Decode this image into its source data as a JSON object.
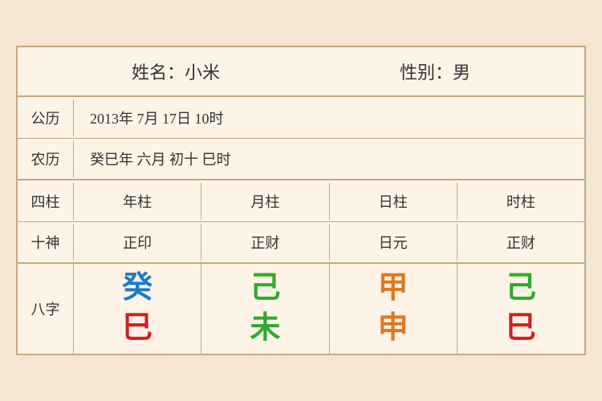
{
  "header": {
    "name_label": "姓名：小米",
    "gender_label": "性别：男"
  },
  "gregorian": {
    "label": "公历",
    "value": "2013年 7月 17日 10时"
  },
  "lunar": {
    "label": "农历",
    "value": "癸巳年 六月 初十 巳时"
  },
  "sipillar": {
    "label": "四柱",
    "year": "年柱",
    "month": "月柱",
    "day": "日柱",
    "hour": "时柱"
  },
  "shishen": {
    "label": "十神",
    "year": "正印",
    "month": "正财",
    "day": "日元",
    "hour": "正财"
  },
  "bazhi": {
    "label": "八字",
    "year_top": "癸",
    "year_bottom": "巳",
    "month_top": "己",
    "month_bottom": "未",
    "day_top": "甲",
    "day_bottom": "申",
    "hour_top": "己",
    "hour_bottom": "巳"
  }
}
